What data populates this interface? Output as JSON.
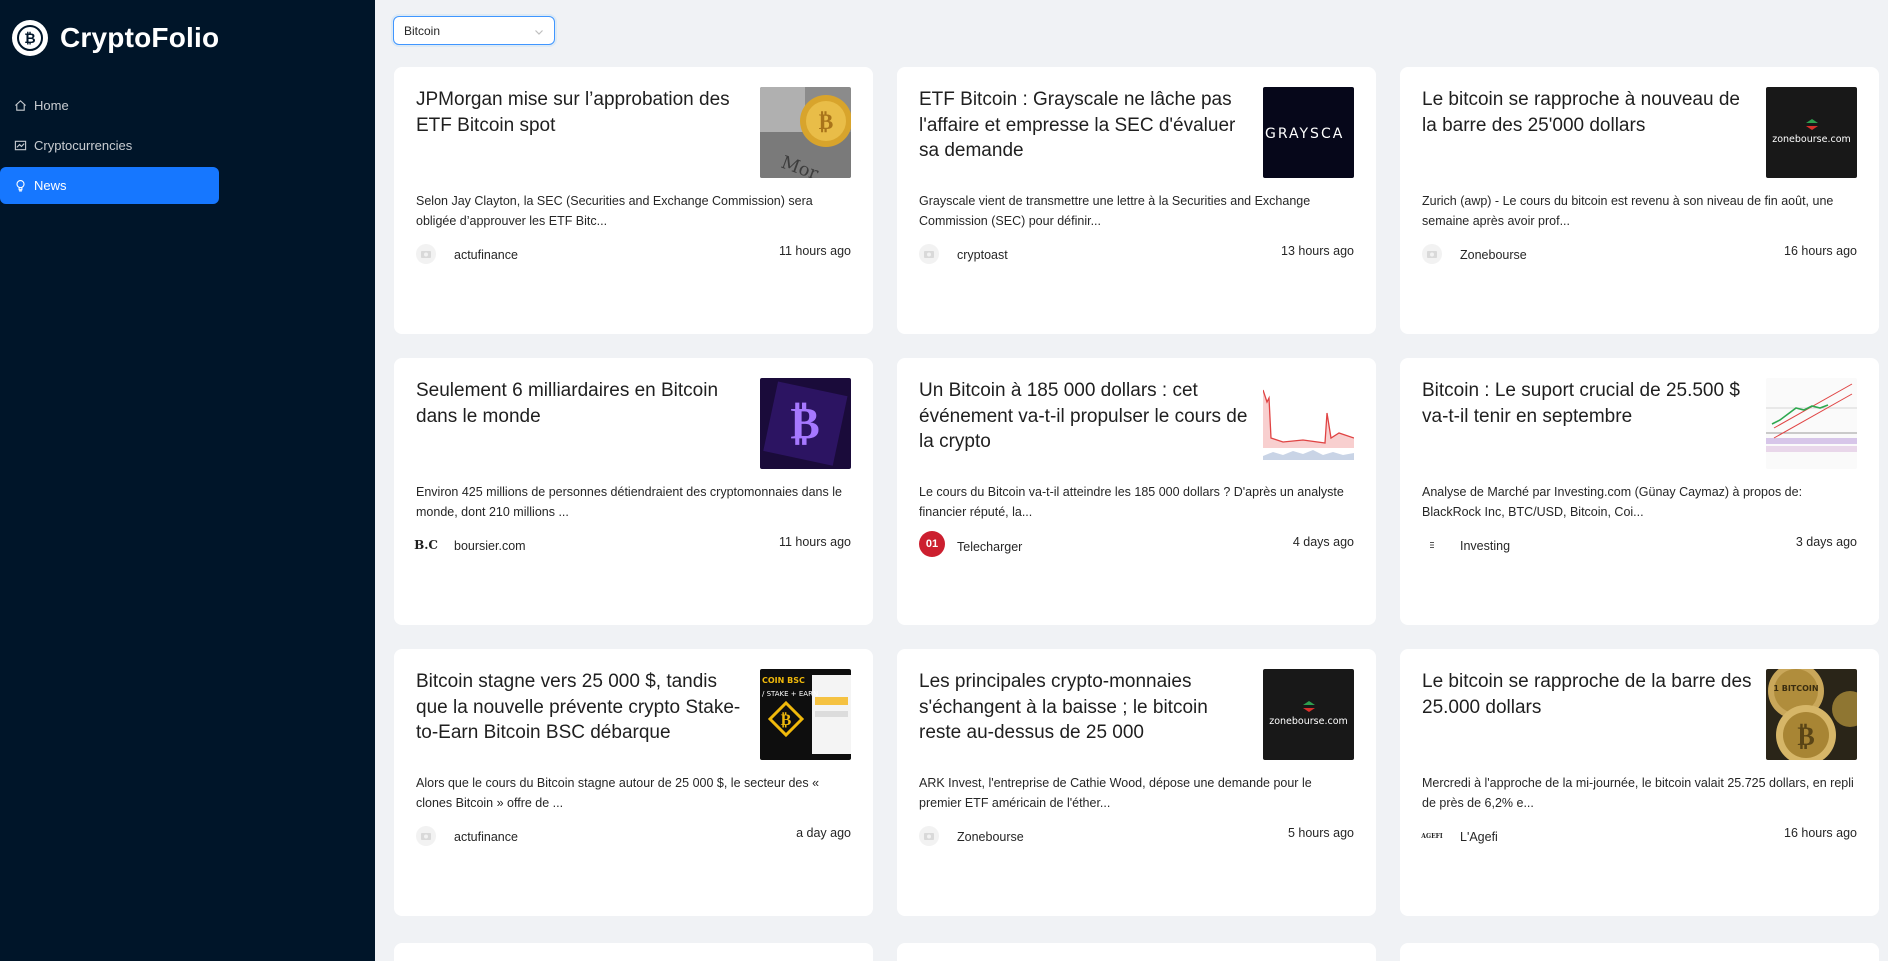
{
  "app": {
    "title": "CryptoFolio"
  },
  "sidebar": {
    "items": [
      {
        "label": "Home",
        "icon": "home-icon"
      },
      {
        "label": "Cryptocurrencies",
        "icon": "fund-icon"
      },
      {
        "label": "News",
        "icon": "bulb-icon",
        "active": true
      }
    ]
  },
  "filter": {
    "selected": "Bitcoin"
  },
  "news": [
    {
      "title": "JPMorgan mise sur l’approbation des ETF Bitcoin spot",
      "description": "Selon Jay Clayton, la SEC (Securities and Exchange Commission) sera obligée d’approuver les ETF Bitc...",
      "provider": "actufinance",
      "time": "11 hours ago",
      "thumb": "gold-coin"
    },
    {
      "title": "ETF Bitcoin : Grayscale ne lâche pas l'affaire et empresse la SEC d'évaluer sa demande",
      "description": "Grayscale vient de transmettre une lettre à la Securities and Exchange Commission (SEC) pour définir...",
      "provider": "cryptoast",
      "time": "13 hours ago",
      "thumb": "grayscale",
      "thumb_text": "GRAYSCA"
    },
    {
      "title": "Le bitcoin se rapproche à nouveau de la barre des 25'000 dollars",
      "description": "Zurich (awp) - Le cours du bitcoin est revenu à son niveau de fin août, une semaine après avoir prof...",
      "provider": "Zonebourse",
      "time": "16 hours ago",
      "thumb": "zonebourse",
      "thumb_text": "zonebourse.com"
    },
    {
      "title": "Seulement 6 milliardaires en Bitcoin dans le monde",
      "description": "Environ 425 millions de personnes détiendraient des cryptomonnaies dans le monde, dont 210 millions ...",
      "provider": "boursier.com",
      "time": "11 hours ago",
      "thumb": "purple-btc",
      "provider_logo": "B.C"
    },
    {
      "title": "Un Bitcoin à 185 000 dollars : cet événement va-t-il propulser le cours de la crypto",
      "description": "Le cours du Bitcoin va-t-il atteindre les 185 000 dollars ? D'après un analyste financier réputé, la...",
      "provider": "Telecharger",
      "time": "4 days ago",
      "thumb": "red-chart",
      "provider_logo": "01"
    },
    {
      "title": "Bitcoin : Le suport crucial de 25.500 $ va-t-il tenir en septembre",
      "description": "Analyse de Marché par Investing.com (Günay Caymaz) à propos de: BlackRock Inc, BTC/USD, Bitcoin, Coi...",
      "provider": "Investing",
      "time": "3 days ago",
      "thumb": "green-chart"
    },
    {
      "title": "Bitcoin stagne vers 25 000 $, tandis que la nouvelle prévente crypto Stake-to-Earn Bitcoin BSC débarque",
      "description": "Alors que le cours du Bitcoin stagne autour de 25 000 $, le secteur des « clones Bitcoin » offre de ...",
      "provider": "actufinance",
      "time": "a day ago",
      "thumb": "bsc",
      "thumb_text": "COIN BSC"
    },
    {
      "title": "Les principales crypto-monnaies s'échangent à la baisse ; le bitcoin reste au-dessus de 25 000",
      "description": "ARK Invest, l'entreprise de Cathie Wood, dépose une demande pour le premier ETF américain de l'éther...",
      "provider": "Zonebourse",
      "time": "5 hours ago",
      "thumb": "zonebourse",
      "thumb_text": "zonebourse.com"
    },
    {
      "title": "Le bitcoin se rapproche de la barre des 25.000 dollars",
      "description": "Mercredi à l'approche de la mi-journée, le bitcoin valait 25.725 dollars, en repli de près de 6,2% e...",
      "provider": "L'Agefi",
      "time": "16 hours ago",
      "thumb": "coins",
      "thumb_text": "1 BITCOIN",
      "provider_logo": "AGEFI"
    }
  ]
}
